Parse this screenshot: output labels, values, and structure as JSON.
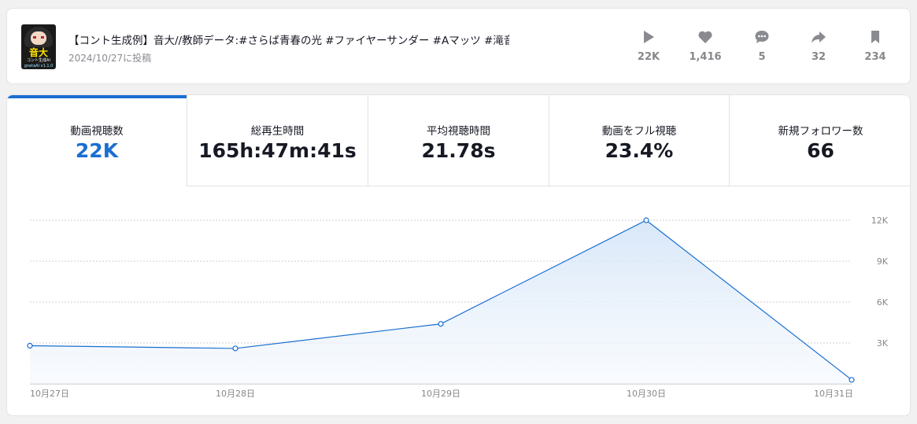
{
  "video": {
    "title": "【コント生成例】音大//教師データ:#さらば青春の光 #ファイヤーサンダー #Aマッツ #滝音 #ライ...",
    "date": "2024/10/27に投稿",
    "thumbnail": {
      "main_text": "音大",
      "sub_text": "コント生成AI",
      "sub_text2": "gnetaAI v1.1.0"
    },
    "stats": [
      {
        "icon": "play-icon",
        "value": "22K"
      },
      {
        "icon": "heart-icon",
        "value": "1,416"
      },
      {
        "icon": "comment-icon",
        "value": "5"
      },
      {
        "icon": "share-icon",
        "value": "32"
      },
      {
        "icon": "bookmark-icon",
        "value": "234"
      }
    ]
  },
  "metrics": [
    {
      "label": "動画視聴数",
      "value": "22K",
      "active": true
    },
    {
      "label": "総再生時間",
      "value": "165h:47m:41s",
      "active": false
    },
    {
      "label": "平均視聴時間",
      "value": "21.78s",
      "active": false
    },
    {
      "label": "動画をフル視聴",
      "value": "23.4%",
      "active": false
    },
    {
      "label": "新規フォロワー数",
      "value": "66",
      "active": false
    }
  ],
  "colors": {
    "accent": "#1a6fd1",
    "area_fill": "#e3eefa",
    "grid": "#cfcfd4",
    "axis_text": "#86878b"
  },
  "chart_data": {
    "type": "area",
    "categories": [
      "10月27日",
      "10月28日",
      "10月29日",
      "10月30日",
      "10月31日"
    ],
    "values": [
      2800,
      2600,
      4400,
      12000,
      300
    ],
    "yticks": [
      3000,
      6000,
      9000,
      12000
    ],
    "ytick_labels": [
      "3K",
      "6K",
      "9K",
      "12K"
    ],
    "ylim": [
      0,
      12000
    ],
    "grid": true
  }
}
